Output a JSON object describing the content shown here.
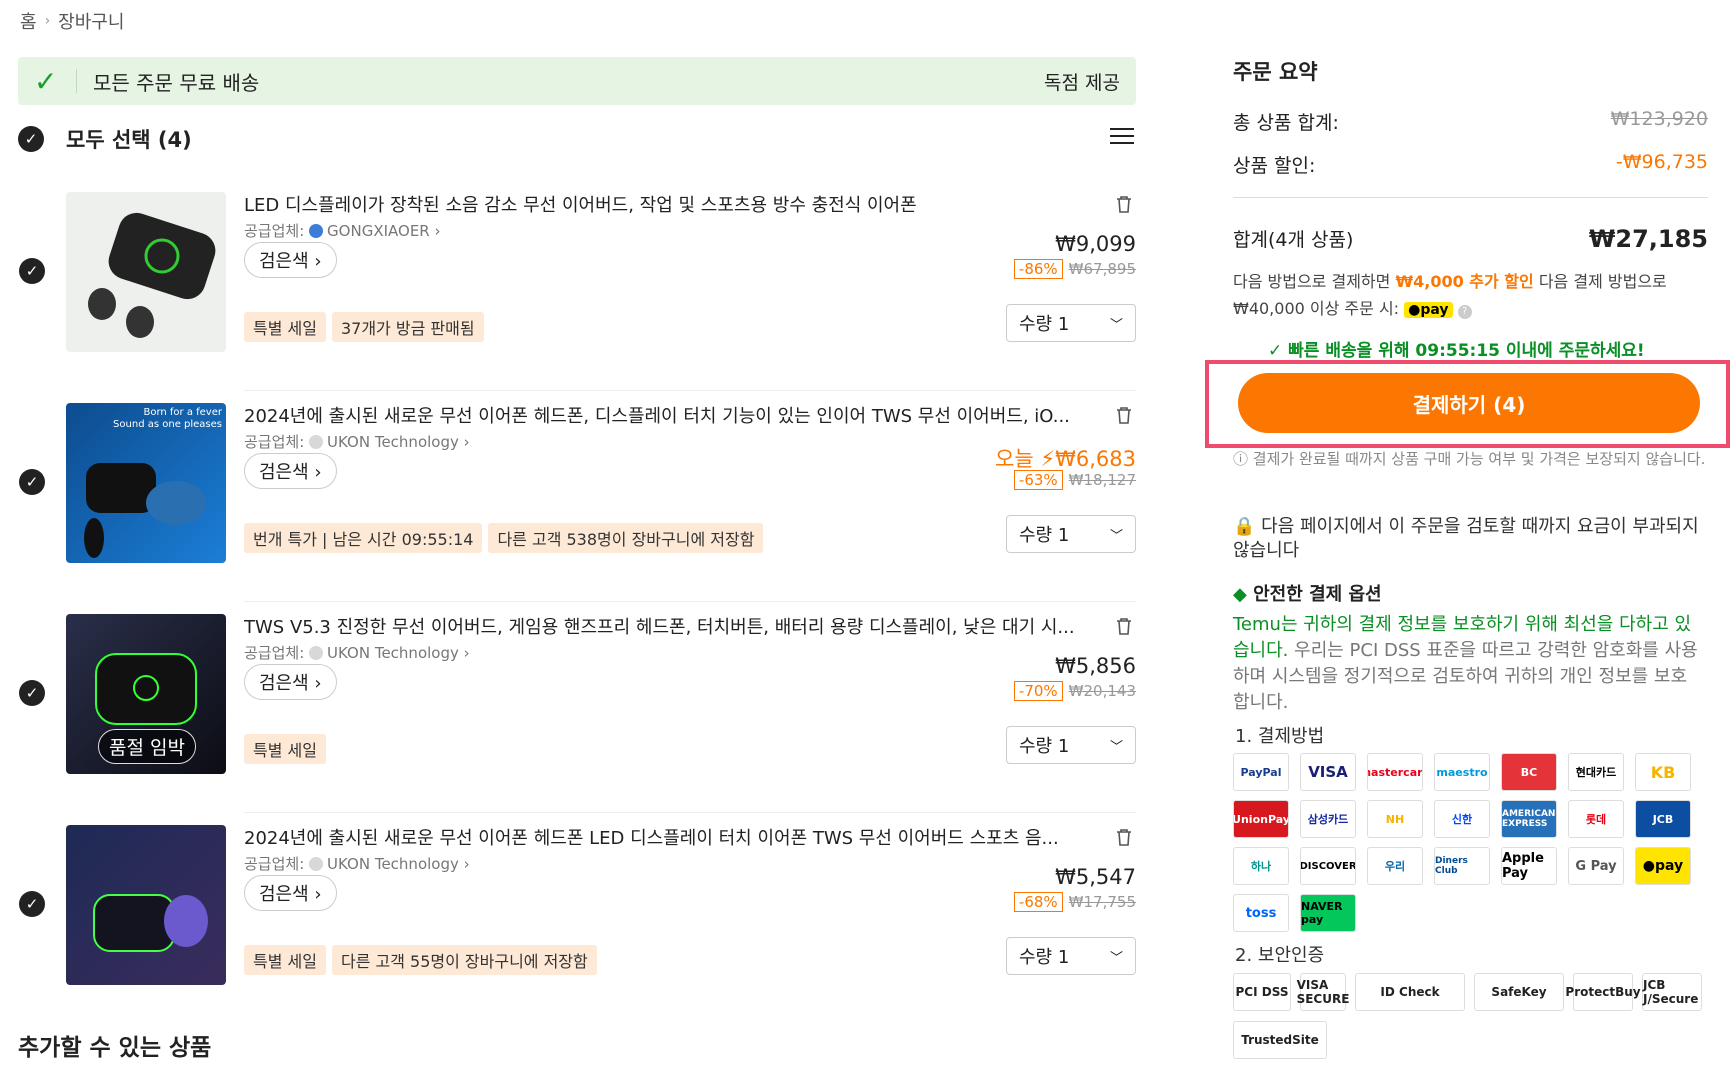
{
  "breadcrumb": {
    "home": "홈",
    "current": "장바구니"
  },
  "banner": {
    "text": "모든 주문 무료 배송",
    "right": "독점 제공"
  },
  "select_all": "모두 선택 (4)",
  "items": [
    {
      "title": "LED 디스플레이가 장착된 소음 감소 무선 이어버드, 작업 및 스포츠용 방수 충전식 이어폰",
      "supplier_label": "공급업체:",
      "supplier": "GONGXIAOER",
      "color": "검은색",
      "price": "₩9,099",
      "price_prefix": "",
      "discount": "-86%",
      "original": "₩67,895",
      "tags": [
        "특별 세일",
        "37개가 방금 판매됨"
      ],
      "qty": "수량 1"
    },
    {
      "title": "2024년에 출시된 새로운 무선 이어폰 헤드폰, 디스플레이 터치 기능이 있는 인이어 TWS 무선 이어버드, iO...",
      "supplier_label": "공급업체:",
      "supplier": "UKON Technology",
      "color": "검은색",
      "price": "₩6,683",
      "price_prefix": "오늘 ⚡",
      "discount": "-63%",
      "original": "₩18,127",
      "tags": [
        "번개 특가 | 남은 시간 09:55:14",
        "다른 고객 538명이 장바구니에 저장함"
      ],
      "qty": "수량 1",
      "promo": "Born for a fever\nSound as one pleases"
    },
    {
      "title": "TWS V5.3 진정한 무선 이어버드, 게임용 핸즈프리 헤드폰, 터치버튼, 배터리 용량 디스플레이, 낮은 대기 시...",
      "supplier_label": "공급업체:",
      "supplier": "UKON Technology",
      "color": "검은색",
      "price": "₩5,856",
      "price_prefix": "",
      "discount": "-70%",
      "original": "₩20,143",
      "tags": [
        "특별 세일"
      ],
      "qty": "수량 1",
      "soldout": "품절 임박"
    },
    {
      "title": "2024년에 출시된 새로운 무선 이어폰 헤드폰 LED 디스플레이 터치 이어폰 TWS 무선 이어버드 스포츠 음...",
      "supplier_label": "공급업체:",
      "supplier": "UKON Technology",
      "color": "검은색",
      "price": "₩5,547",
      "price_prefix": "",
      "discount": "-68%",
      "original": "₩17,755",
      "tags": [
        "특별 세일",
        "다른 고객 55명이 장바구니에 저장함"
      ],
      "qty": "수량 1"
    }
  ],
  "add_more": "추가할 수 있는 상품",
  "summary": {
    "title": "주문 요약",
    "subtotal_label": "총 상품 합계:",
    "subtotal": "₩123,920",
    "discount_label": "상품 할인:",
    "discount": "-₩96,735",
    "total_label": "합계(4개 상품)",
    "total": "₩27,185",
    "promo_a": "다음 방법으로 결제하면 ",
    "promo_b": "₩4,000 추가 할인",
    "promo_c": " 다음 결제 방법으로 ₩40,000 이상 주문 시: ",
    "npay": "●pay",
    "fast": "빠른 배송을 위해 09:55:15 이내에 주문하세요!",
    "checkout": "결제하기 (4)",
    "note": "결제가 완료될 때까지 상품 구매 가능 여부 및 가격은 보장되지 않습니다.",
    "lock": "다음 페이지에서 이 주문을 검토할 때까지 요금이 부과되지 않습니다",
    "secure_title": "안전한 결제 옵션",
    "secure_a": "Temu는 귀하의 결제 정보를 보호하기 위해 최선을 다하고 있습니다.",
    "secure_b": " 우리는 PCI DSS 표준을 따르고 강력한 암호화를 사용하며 시스템을 정기적으로 검토하여 귀하의 개인 정보를 보호합니다.",
    "pay_label": "1. 결제방법",
    "auth_label": "2. 보안인증"
  },
  "payments": [
    "PayPal",
    "VISA",
    "mastercard",
    "maestro",
    "BC",
    "현대카드",
    "KB",
    "UnionPay",
    "삼성카드",
    "NH",
    "신한",
    "AMERICAN EXPRESS",
    "롯데",
    "JCB",
    "하나",
    "DISCOVER",
    "우리",
    "Diners Club",
    "Apple Pay",
    "G Pay",
    "●pay",
    "toss",
    "NAVER pay"
  ],
  "certs": [
    "PCI DSS",
    "VISA SECURE",
    "ID Check",
    "SafeKey",
    "ProtectBuy",
    "JCB J/Secure",
    "TrustedSite"
  ]
}
